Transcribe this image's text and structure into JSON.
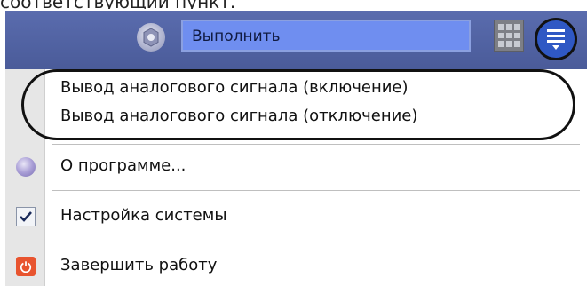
{
  "caption": "соответствующий пункт.",
  "toolbar": {
    "execute_field_value": "Выполнить"
  },
  "menu": {
    "items": [
      {
        "label": "Вывод аналогового сигнала (включение)"
      },
      {
        "label": "Вывод аналогового сигнала (отключение)"
      },
      {
        "label": "О программе..."
      },
      {
        "label": "Настройка системы"
      },
      {
        "label": "Завершить работу"
      }
    ]
  },
  "icons": {
    "gear": "gear-icon",
    "grid": "grid-icon",
    "menu": "hamburger-menu-icon",
    "about": "about-icon",
    "settings_check": "checkmark-icon",
    "exit": "power-icon"
  },
  "colors": {
    "toolbar": "#4f61a3",
    "input_bg": "#6f8ef0",
    "menu_button": "#2f58c4",
    "exit_icon": "#e8542f"
  }
}
